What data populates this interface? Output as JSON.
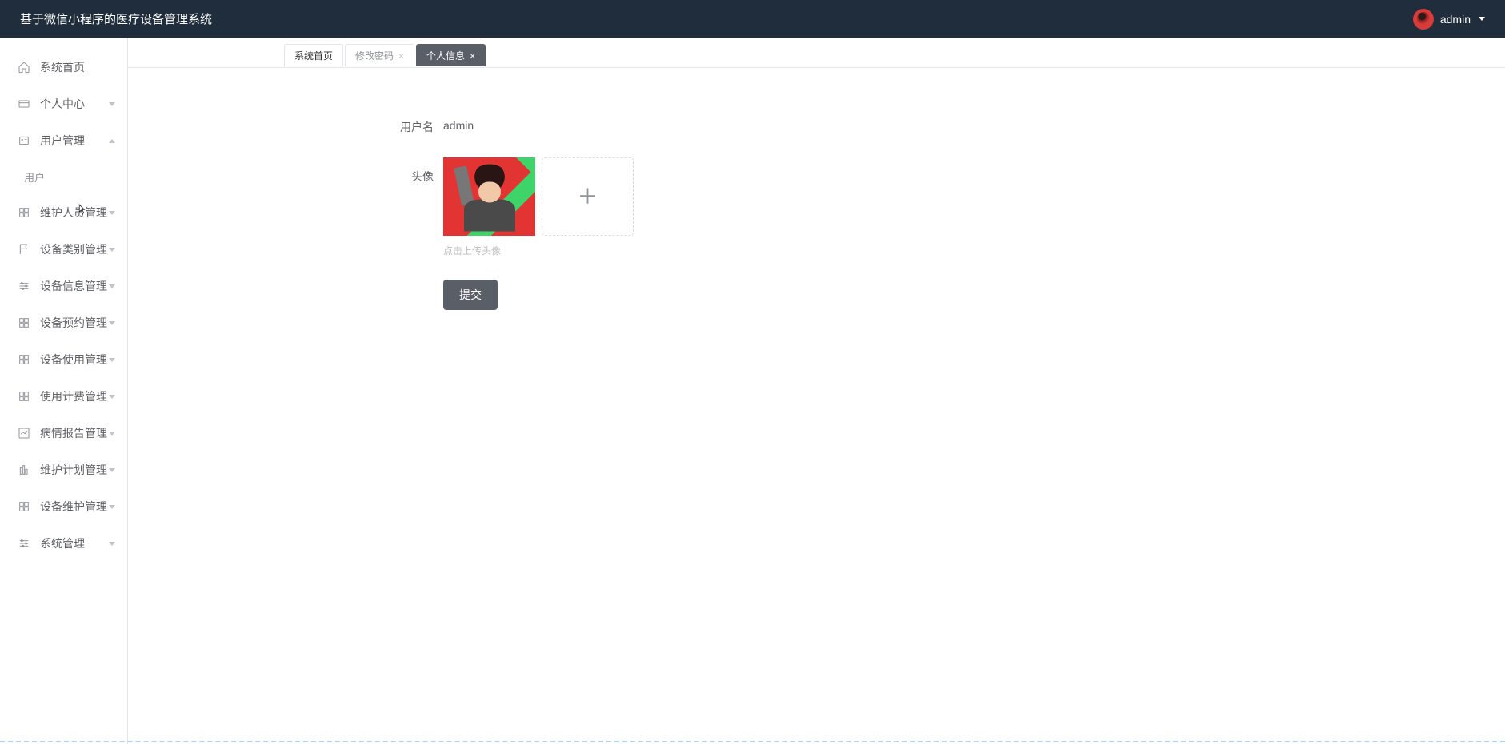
{
  "header": {
    "title": "基于微信小程序的医疗设备管理系统",
    "username": "admin"
  },
  "sidebar": {
    "items": [
      {
        "label": "系统首页",
        "icon": "home",
        "expandable": false
      },
      {
        "label": "个人中心",
        "icon": "card",
        "expandable": true,
        "expanded": false
      },
      {
        "label": "用户管理",
        "icon": "users",
        "expandable": true,
        "expanded": true,
        "children": [
          {
            "label": "用户"
          }
        ]
      },
      {
        "label": "维护人员管理",
        "icon": "grid",
        "expandable": true,
        "expanded": false
      },
      {
        "label": "设备类别管理",
        "icon": "flag",
        "expandable": true,
        "expanded": false
      },
      {
        "label": "设备信息管理",
        "icon": "sliders",
        "expandable": true,
        "expanded": false
      },
      {
        "label": "设备预约管理",
        "icon": "grid",
        "expandable": true,
        "expanded": false
      },
      {
        "label": "设备使用管理",
        "icon": "grid",
        "expandable": true,
        "expanded": false
      },
      {
        "label": "使用计费管理",
        "icon": "grid",
        "expandable": true,
        "expanded": false
      },
      {
        "label": "病情报告管理",
        "icon": "chart",
        "expandable": true,
        "expanded": false
      },
      {
        "label": "维护计划管理",
        "icon": "bars",
        "expandable": true,
        "expanded": false
      },
      {
        "label": "设备维护管理",
        "icon": "grid",
        "expandable": true,
        "expanded": false
      },
      {
        "label": "系统管理",
        "icon": "sliders",
        "expandable": true,
        "expanded": false
      }
    ]
  },
  "tabs": [
    {
      "label": "系统首页",
      "closable": false,
      "active": false
    },
    {
      "label": "修改密码",
      "closable": true,
      "active": false
    },
    {
      "label": "个人信息",
      "closable": true,
      "active": true
    }
  ],
  "form": {
    "username_label": "用户名",
    "username_value": "admin",
    "avatar_label": "头像",
    "upload_hint": "点击上传头像",
    "submit_label": "提交"
  }
}
